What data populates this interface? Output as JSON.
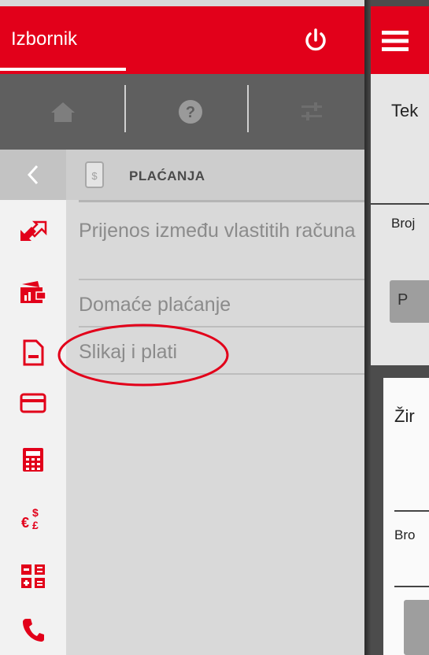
{
  "drawer": {
    "title": "Izbornik",
    "section_title": "PLAĆANJA",
    "menu_items": [
      {
        "label": "Prijenos između vlastitih računa"
      },
      {
        "label": "Domaće plaćanje"
      },
      {
        "label": "Slikaj i plati"
      }
    ],
    "quickbar": [
      "home-icon",
      "help-icon",
      "settings-sliders-icon"
    ],
    "rail_icons": [
      "transfer-arrows-icon",
      "wallet-icon",
      "document-icon",
      "card-icon",
      "calculator-icon",
      "currency-exchange-icon",
      "grid-icon",
      "phone-icon"
    ]
  },
  "app": {
    "header_partial": "Tek",
    "broj_label_1": "Broj",
    "button_partial": "P",
    "card_title_partial": "Žir",
    "broj_label_2": "Bro"
  },
  "colors": {
    "brand_red": "#e2001a",
    "quickbar_gray": "#5f5f5f",
    "drawer_gray": "#d9d9d9",
    "highlight": "#e2001a"
  }
}
